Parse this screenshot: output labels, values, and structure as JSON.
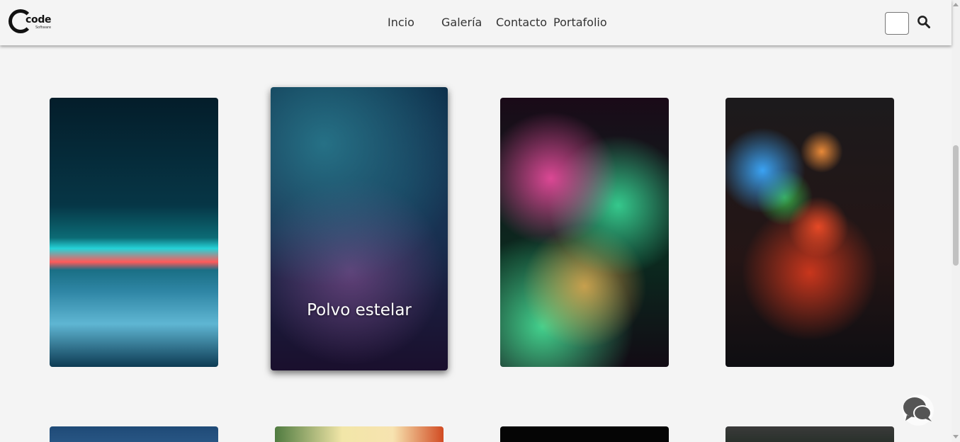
{
  "brand": {
    "logo_text": "code",
    "logo_sub": "Software"
  },
  "nav": {
    "items": [
      "Incio",
      "Galería",
      "Contacto",
      "Portafolio"
    ]
  },
  "search": {
    "value": "",
    "placeholder": ""
  },
  "icons": {
    "search": "search-icon",
    "chat": "chat-bubbles-icon"
  },
  "gallery": {
    "row1": [
      {
        "caption": ""
      },
      {
        "caption": "Polvo estelar"
      },
      {
        "caption": ""
      },
      {
        "caption": ""
      }
    ]
  },
  "colors": {
    "background": "#f4f4f4",
    "text": "#333333",
    "logo": "#111111"
  }
}
